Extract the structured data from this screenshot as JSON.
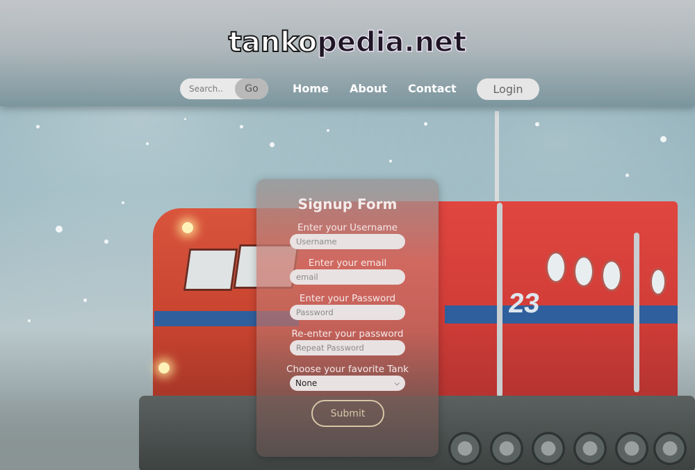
{
  "site": {
    "logo_part1": "tanko",
    "logo_part2": "pedia.net"
  },
  "header": {
    "search": {
      "placeholder": "Search..",
      "button_label": "Go"
    },
    "nav": [
      {
        "label": "Home"
      },
      {
        "label": "About"
      },
      {
        "label": "Contact"
      }
    ],
    "login_label": "Login"
  },
  "form": {
    "title": "Signup Form",
    "fields": [
      {
        "label": "Enter your Username",
        "placeholder": "Username"
      },
      {
        "label": "Enter your email",
        "placeholder": "email"
      },
      {
        "label": "Enter your Password",
        "placeholder": "Password"
      },
      {
        "label": "Re-enter your password",
        "placeholder": "Repeat Password"
      }
    ],
    "select": {
      "label": "Choose your favorite Tank",
      "value": "None"
    },
    "submit_label": "Submit"
  },
  "background": {
    "vehicle_number": "23"
  },
  "colors": {
    "header_top": "#c4c6c9",
    "vehicle_red": "#d23d38",
    "stripe_blue": "#2f5f9c",
    "submit_outline": "#d6c7a8"
  }
}
